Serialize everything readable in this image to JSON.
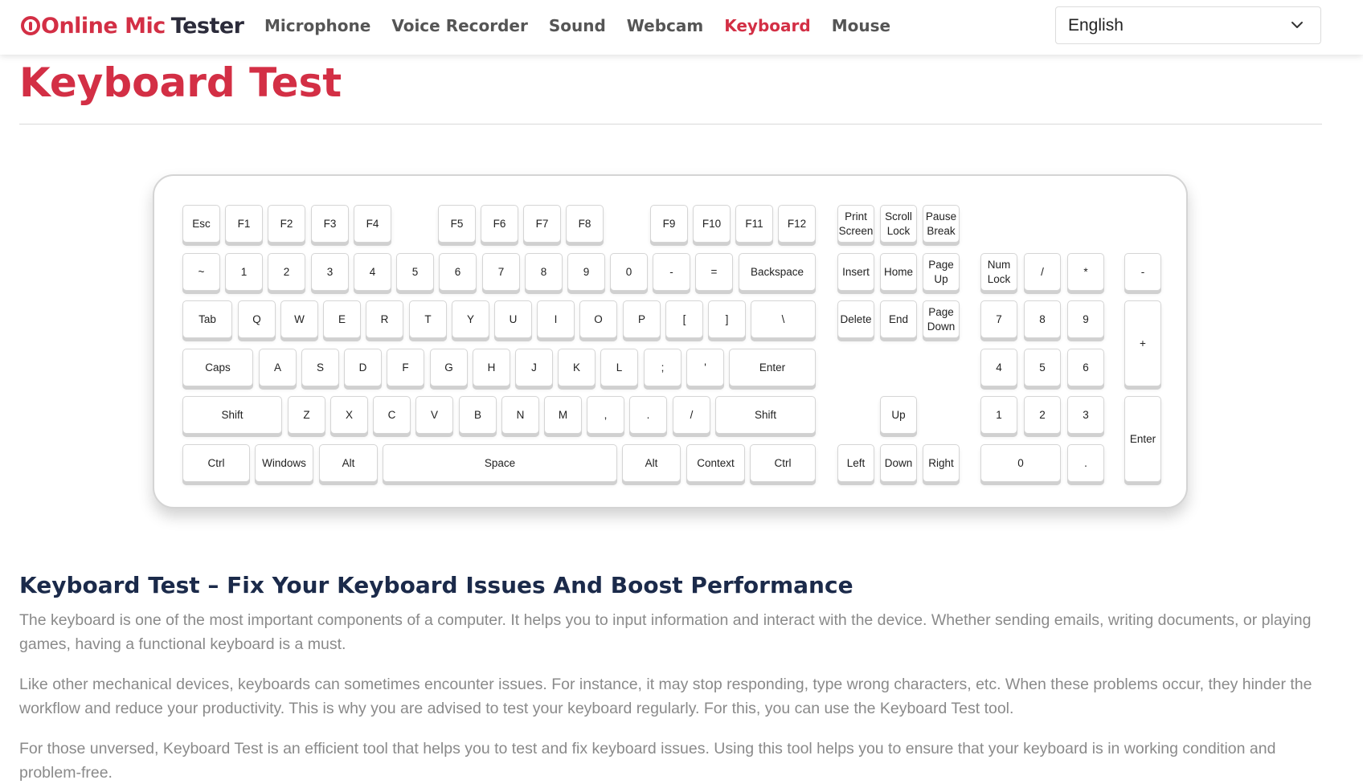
{
  "header": {
    "logo_part1": "Online Mic",
    "logo_part2": "Tester",
    "nav": [
      {
        "label": "Microphone",
        "active": false
      },
      {
        "label": "Voice Recorder",
        "active": false
      },
      {
        "label": "Sound",
        "active": false
      },
      {
        "label": "Webcam",
        "active": false
      },
      {
        "label": "Keyboard",
        "active": true
      },
      {
        "label": "Mouse",
        "active": false
      }
    ],
    "language": "English",
    "language_icon": "chevron-down-icon"
  },
  "page": {
    "title": "Keyboard Test"
  },
  "keyboard": {
    "keys": [
      {
        "id": "esc",
        "label": "Esc"
      },
      {
        "id": "f1",
        "label": "F1"
      },
      {
        "id": "f2",
        "label": "F2"
      },
      {
        "id": "f3",
        "label": "F3"
      },
      {
        "id": "f4",
        "label": "F4"
      },
      {
        "id": "f5",
        "label": "F5"
      },
      {
        "id": "f6",
        "label": "F6"
      },
      {
        "id": "f7",
        "label": "F7"
      },
      {
        "id": "f8",
        "label": "F8"
      },
      {
        "id": "f9",
        "label": "F9"
      },
      {
        "id": "f10",
        "label": "F10"
      },
      {
        "id": "f11",
        "label": "F11"
      },
      {
        "id": "f12",
        "label": "F12"
      },
      {
        "id": "print-screen",
        "label": "Print\nScreen"
      },
      {
        "id": "scroll-lock",
        "label": "Scroll\nLock"
      },
      {
        "id": "pause-break",
        "label": "Pause\nBreak"
      },
      {
        "id": "tilde",
        "label": "~"
      },
      {
        "id": "1",
        "label": "1"
      },
      {
        "id": "2",
        "label": "2"
      },
      {
        "id": "3",
        "label": "3"
      },
      {
        "id": "4",
        "label": "4"
      },
      {
        "id": "5",
        "label": "5"
      },
      {
        "id": "6",
        "label": "6"
      },
      {
        "id": "7",
        "label": "7"
      },
      {
        "id": "8",
        "label": "8"
      },
      {
        "id": "9",
        "label": "9"
      },
      {
        "id": "0",
        "label": "0"
      },
      {
        "id": "minus",
        "label": "-"
      },
      {
        "id": "equals",
        "label": "="
      },
      {
        "id": "backspace",
        "label": "Backspace"
      },
      {
        "id": "insert",
        "label": "Insert"
      },
      {
        "id": "home",
        "label": "Home"
      },
      {
        "id": "page-up",
        "label": "Page\nUp"
      },
      {
        "id": "num-lock",
        "label": "Num\nLock"
      },
      {
        "id": "num-divide",
        "label": "/"
      },
      {
        "id": "num-multiply",
        "label": "*"
      },
      {
        "id": "num-minus",
        "label": "-"
      },
      {
        "id": "tab",
        "label": "Tab"
      },
      {
        "id": "q",
        "label": "Q"
      },
      {
        "id": "w",
        "label": "W"
      },
      {
        "id": "e",
        "label": "E"
      },
      {
        "id": "r",
        "label": "R"
      },
      {
        "id": "t",
        "label": "T"
      },
      {
        "id": "y",
        "label": "Y"
      },
      {
        "id": "u",
        "label": "U"
      },
      {
        "id": "i",
        "label": "I"
      },
      {
        "id": "o",
        "label": "O"
      },
      {
        "id": "p",
        "label": "P"
      },
      {
        "id": "lbracket",
        "label": "["
      },
      {
        "id": "rbracket",
        "label": "]"
      },
      {
        "id": "backslash",
        "label": "\\"
      },
      {
        "id": "delete",
        "label": "Delete"
      },
      {
        "id": "end",
        "label": "End"
      },
      {
        "id": "page-down",
        "label": "Page\nDown"
      },
      {
        "id": "num-7",
        "label": "7"
      },
      {
        "id": "num-8",
        "label": "8"
      },
      {
        "id": "num-9",
        "label": "9"
      },
      {
        "id": "num-plus",
        "label": "+"
      },
      {
        "id": "caps",
        "label": "Caps"
      },
      {
        "id": "a",
        "label": "A"
      },
      {
        "id": "s",
        "label": "S"
      },
      {
        "id": "d",
        "label": "D"
      },
      {
        "id": "f",
        "label": "F"
      },
      {
        "id": "g",
        "label": "G"
      },
      {
        "id": "h",
        "label": "H"
      },
      {
        "id": "j",
        "label": "J"
      },
      {
        "id": "k",
        "label": "K"
      },
      {
        "id": "l",
        "label": "L"
      },
      {
        "id": "semicolon",
        "label": ";"
      },
      {
        "id": "quote",
        "label": "'"
      },
      {
        "id": "enter",
        "label": "Enter"
      },
      {
        "id": "num-4",
        "label": "4"
      },
      {
        "id": "num-5",
        "label": "5"
      },
      {
        "id": "num-6",
        "label": "6"
      },
      {
        "id": "lshift",
        "label": "Shift"
      },
      {
        "id": "z",
        "label": "Z"
      },
      {
        "id": "x",
        "label": "X"
      },
      {
        "id": "c",
        "label": "C"
      },
      {
        "id": "v",
        "label": "V"
      },
      {
        "id": "b",
        "label": "B"
      },
      {
        "id": "n",
        "label": "N"
      },
      {
        "id": "m",
        "label": "M"
      },
      {
        "id": "comma",
        "label": ","
      },
      {
        "id": "period",
        "label": "."
      },
      {
        "id": "slash",
        "label": "/"
      },
      {
        "id": "rshift",
        "label": "Shift"
      },
      {
        "id": "up",
        "label": "Up"
      },
      {
        "id": "num-1",
        "label": "1"
      },
      {
        "id": "num-2",
        "label": "2"
      },
      {
        "id": "num-3",
        "label": "3"
      },
      {
        "id": "num-enter",
        "label": "Enter"
      },
      {
        "id": "lctrl",
        "label": "Ctrl"
      },
      {
        "id": "windows",
        "label": "Windows"
      },
      {
        "id": "lalt",
        "label": "Alt"
      },
      {
        "id": "space",
        "label": "Space"
      },
      {
        "id": "ralt",
        "label": "Alt"
      },
      {
        "id": "context",
        "label": "Context"
      },
      {
        "id": "rctrl",
        "label": "Ctrl"
      },
      {
        "id": "left",
        "label": "Left"
      },
      {
        "id": "down",
        "label": "Down"
      },
      {
        "id": "right",
        "label": "Right"
      },
      {
        "id": "num-0",
        "label": "0"
      },
      {
        "id": "num-decimal",
        "label": "."
      }
    ]
  },
  "article": {
    "heading": "Keyboard Test – Fix Your Keyboard Issues And Boost Performance",
    "paragraphs": [
      "The keyboard is one of the most important components of a computer. It helps you to input information and interact with the device. Whether sending emails, writing documents, or playing games, having a functional keyboard is a must.",
      "Like other mechanical devices, keyboards can sometimes encounter issues. For instance, it may stop responding, type wrong characters, etc. When these problems occur, they hinder the workflow and reduce your productivity. This is why you are advised to test your keyboard regularly. For this, you can use the Keyboard Test tool.",
      "For those unversed, Keyboard Test is an efficient tool that helps you to test and fix keyboard issues. Using this tool helps you to ensure that your keyboard is in working condition and problem-free."
    ]
  },
  "colors": {
    "brand_red": "#d32f45",
    "heading_navy": "#1b2a4a",
    "body_gray": "#8a8a8a"
  }
}
